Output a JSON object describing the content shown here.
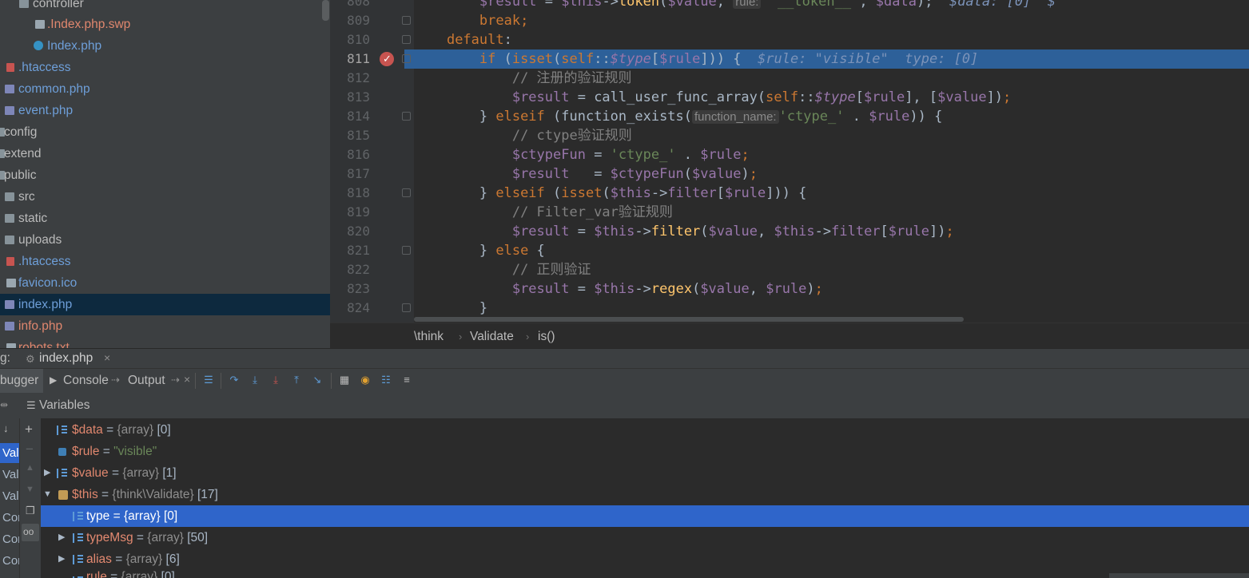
{
  "project_tree": {
    "items": [
      {
        "label": "controller",
        "kind": "folder"
      },
      {
        "label": ".Index.php.swp",
        "kind": "file"
      },
      {
        "label": "Index.php",
        "kind": "class"
      },
      {
        "label": ".htaccess",
        "kind": "htaccess"
      },
      {
        "label": "common.php",
        "kind": "php"
      },
      {
        "label": "event.php",
        "kind": "php"
      },
      {
        "label": "config",
        "kind": "folder"
      },
      {
        "label": "extend",
        "kind": "folder"
      },
      {
        "label": "public",
        "kind": "folder"
      },
      {
        "label": "src",
        "kind": "folder"
      },
      {
        "label": "static",
        "kind": "folder"
      },
      {
        "label": "uploads",
        "kind": "folder"
      },
      {
        "label": ".htaccess",
        "kind": "htaccess"
      },
      {
        "label": "favicon.ico",
        "kind": "file"
      },
      {
        "label": "index.php",
        "kind": "php",
        "selected": true
      },
      {
        "label": "info.php",
        "kind": "php"
      },
      {
        "label": "robots.txt",
        "kind": "file"
      }
    ]
  },
  "editor": {
    "line_numbers": [
      "808",
      "809",
      "810",
      "811",
      "812",
      "813",
      "814",
      "815",
      "816",
      "817",
      "818",
      "819",
      "820",
      "821",
      "822",
      "823",
      "824"
    ],
    "current_line": "811",
    "hint_rule": "rule:",
    "hint_function_name": "function_name:",
    "inline_808": "$data: [0]  $",
    "inline_811_rule": "$rule: \"visible\"",
    "inline_811_type": "type: [0]",
    "comment_812": "// 注册的验证规则",
    "comment_815": "// ctype验证规则",
    "comment_819": "// Filter_var验证规则",
    "comment_822": "// 正则验证"
  },
  "breadcrumb": [
    "\\think",
    "Validate",
    "is()"
  ],
  "debug": {
    "tab_prefix": "g:",
    "session_tab": "index.php",
    "tabs": [
      "bugger",
      "Console",
      "Output"
    ],
    "panel_title": "Variables",
    "frames": [
      "Val",
      "Val",
      "Val",
      "Con",
      "Con",
      "Con"
    ],
    "variables": [
      {
        "name": "$data",
        "type": "{array}",
        "count": "[0]"
      },
      {
        "name": "$rule",
        "eq": "=",
        "value": "\"visible\""
      },
      {
        "name": "$value",
        "type": "{array}",
        "count": "[1]"
      },
      {
        "name": "$this",
        "type": "{think\\Validate}",
        "count": "[17]"
      },
      {
        "name": "type",
        "type": "{array}",
        "count": "[0]"
      },
      {
        "name": "typeMsg",
        "type": "{array}",
        "count": "[50]"
      },
      {
        "name": "alias",
        "type": "{array}",
        "count": "[6]"
      },
      {
        "name": "rule",
        "type": "{array}",
        "count": "[0]"
      }
    ]
  },
  "colors": {
    "accent_selection": "#2f65ca",
    "execution_line": "#2d6099",
    "breakpoint": "#c75450"
  }
}
